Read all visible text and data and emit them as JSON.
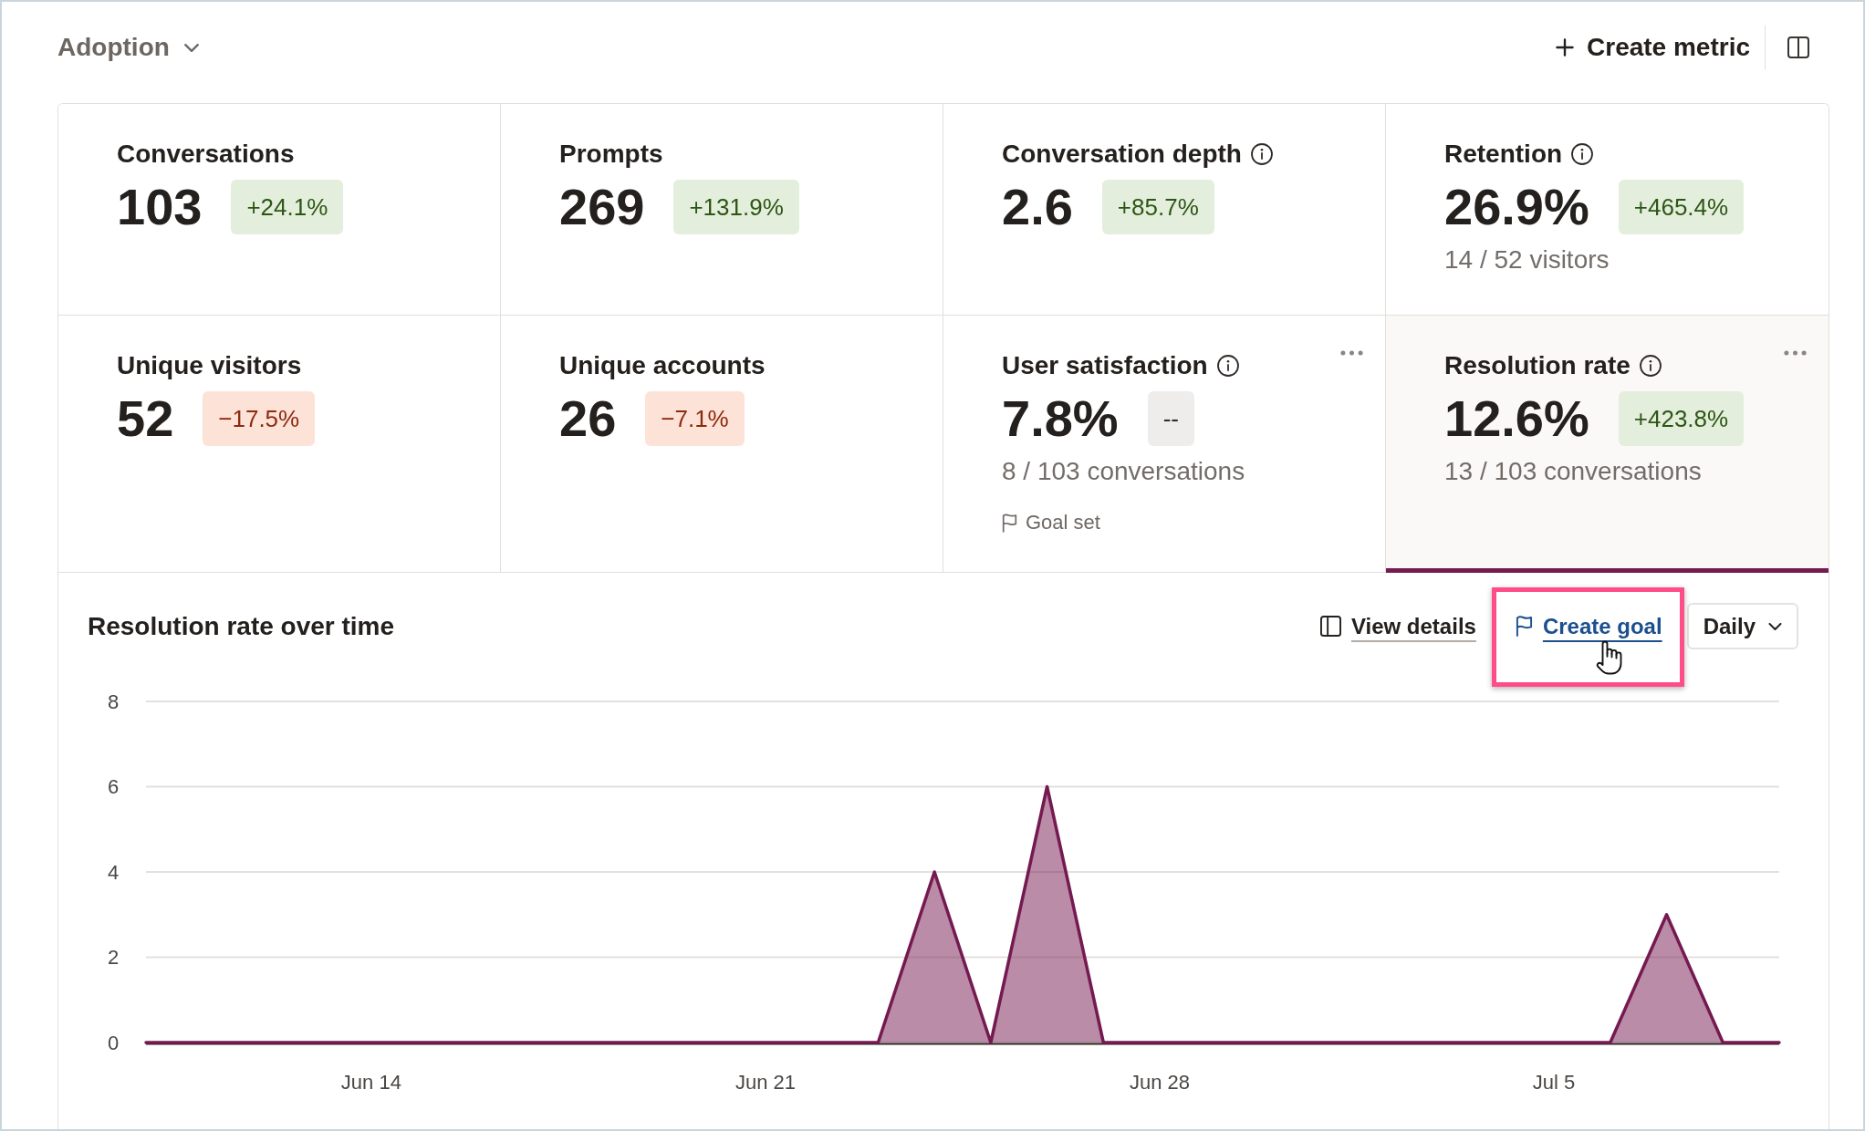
{
  "header": {
    "title": "Adoption",
    "create_button": "Create metric"
  },
  "metrics": [
    {
      "title": "Conversations",
      "info": false,
      "value": "103",
      "change": {
        "text": "+24.1%",
        "kind": "positive"
      },
      "menu": false,
      "selected": false
    },
    {
      "title": "Prompts",
      "info": false,
      "value": "269",
      "change": {
        "text": "+131.9%",
        "kind": "positive"
      },
      "menu": false,
      "selected": false
    },
    {
      "title": "Conversation depth",
      "info": true,
      "value": "2.6",
      "change": {
        "text": "+85.7%",
        "kind": "positive"
      },
      "menu": false,
      "selected": false
    },
    {
      "title": "Retention",
      "info": true,
      "value": "26.9%",
      "change": {
        "text": "+465.4%",
        "kind": "positive"
      },
      "subtitle": "14 / 52 visitors",
      "menu": false,
      "selected": false
    },
    {
      "title": "Unique visitors",
      "info": false,
      "value": "52",
      "change": {
        "text": "−17.5%",
        "kind": "negative"
      },
      "menu": false,
      "selected": false
    },
    {
      "title": "Unique accounts",
      "info": false,
      "value": "26",
      "change": {
        "text": "−7.1%",
        "kind": "negative"
      },
      "menu": false,
      "selected": false
    },
    {
      "title": "User satisfaction",
      "info": true,
      "value": "7.8%",
      "change": {
        "text": "--",
        "kind": "neutral"
      },
      "subtitle": "8 / 103 conversations",
      "goal": "Goal set",
      "menu": true,
      "selected": false
    },
    {
      "title": "Resolution rate",
      "info": true,
      "value": "12.6%",
      "change": {
        "text": "+423.8%",
        "kind": "positive"
      },
      "subtitle": "13 / 103 conversations",
      "menu": true,
      "selected": true
    }
  ],
  "chart_panel": {
    "title": "Resolution rate over time",
    "actions": [
      {
        "kind": "details",
        "label": "View details",
        "hovered": false,
        "highlighted": false
      },
      {
        "kind": "goal",
        "label": "Create goal",
        "hovered": true,
        "highlighted": true
      }
    ],
    "interval": "Daily",
    "chart_data": {
      "type": "area",
      "categories": [
        null,
        null,
        null,
        null,
        "Jun 14",
        null,
        null,
        null,
        null,
        null,
        null,
        "Jun 21",
        null,
        null,
        null,
        null,
        null,
        null,
        "Jun 28",
        null,
        null,
        null,
        null,
        null,
        null,
        "Jul 5",
        null,
        null,
        null,
        null
      ],
      "series": [
        {
          "color": "#751a50",
          "values": [
            0,
            0,
            0,
            0,
            0,
            0,
            0,
            0,
            0,
            0,
            0,
            0,
            0,
            0,
            4,
            0,
            6,
            0,
            0,
            0,
            0,
            0,
            0,
            0,
            0,
            0,
            0,
            3,
            0,
            0
          ]
        }
      ],
      "ylim": [
        0,
        8
      ],
      "yticks": [
        0,
        2,
        4,
        6,
        8
      ],
      "grid": true
    }
  }
}
